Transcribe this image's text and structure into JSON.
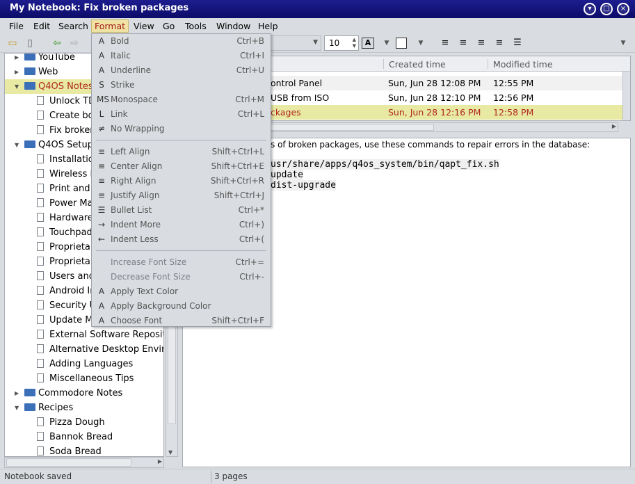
{
  "window": {
    "title": "My Notebook: Fix broken packages"
  },
  "menubar": [
    "File",
    "Edit",
    "Search",
    "Format",
    "View",
    "Go",
    "Tools",
    "Window",
    "Help"
  ],
  "toolbar": {
    "font_size": "10"
  },
  "tree": [
    {
      "label": "YouTube",
      "type": "folder",
      "level": 1,
      "expander": "collapsed"
    },
    {
      "label": "Web",
      "type": "folder",
      "level": 1,
      "expander": "collapsed"
    },
    {
      "label": "Q4OS Notes",
      "type": "folder",
      "level": 1,
      "expander": "expanded",
      "selected": true
    },
    {
      "label": "Unlock TDE",
      "type": "page",
      "level": 2
    },
    {
      "label": "Create boo",
      "type": "page",
      "level": 2
    },
    {
      "label": "Fix broken",
      "type": "page",
      "level": 2
    },
    {
      "label": "Q4OS Setup",
      "type": "folder",
      "level": 1,
      "expander": "expanded"
    },
    {
      "label": "Installation",
      "type": "page",
      "level": 2
    },
    {
      "label": "Wireless N",
      "type": "page",
      "level": 2
    },
    {
      "label": "Print and S",
      "type": "page",
      "level": 2
    },
    {
      "label": "Power Man",
      "type": "page",
      "level": 2
    },
    {
      "label": "Hardware",
      "type": "page",
      "level": 2
    },
    {
      "label": "Touchpad",
      "type": "page",
      "level": 2
    },
    {
      "label": "Proprietary",
      "type": "page",
      "level": 2
    },
    {
      "label": "Proprietary",
      "type": "page",
      "level": 2
    },
    {
      "label": "Users and",
      "type": "page",
      "level": 2
    },
    {
      "label": "Android In",
      "type": "page",
      "level": 2
    },
    {
      "label": "Security Up",
      "type": "page",
      "level": 2
    },
    {
      "label": "Update Ma",
      "type": "page",
      "level": 2
    },
    {
      "label": "External Software Repositori",
      "type": "page",
      "level": 2
    },
    {
      "label": "Alternative Desktop Environn",
      "type": "page",
      "level": 2
    },
    {
      "label": "Adding Languages",
      "type": "page",
      "level": 2
    },
    {
      "label": "Miscellaneous Tips",
      "type": "page",
      "level": 2
    },
    {
      "label": "Commodore Notes",
      "type": "folder",
      "level": 1,
      "expander": "collapsed"
    },
    {
      "label": "Recipes",
      "type": "folder",
      "level": 1,
      "expander": "expanded"
    },
    {
      "label": "Pizza Dough",
      "type": "page",
      "level": 2
    },
    {
      "label": "Bannok Bread",
      "type": "page",
      "level": 2
    },
    {
      "label": "Soda Bread",
      "type": "page",
      "level": 2
    }
  ],
  "pages_list": {
    "columns": [
      "Created time",
      "Modified time"
    ],
    "rows": [
      {
        "title": "ontrol Panel",
        "created": "Sun, Jun 28 12:08 PM",
        "modified": "12:55 PM"
      },
      {
        "title": "USB from ISO",
        "created": "Sun, Jun 28 12:10 PM",
        "modified": "12:56 PM"
      },
      {
        "title": "ckages",
        "created": "Sun, Jun 28 12:16 PM",
        "modified": "12:58 PM",
        "selected": true
      }
    ]
  },
  "editor": {
    "lines": [
      "s of broken packages, use these commands to repair errors in the database:",
      "usr/share/apps/q4os_system/bin/qapt_fix.sh",
      "update",
      "dist-upgrade"
    ]
  },
  "format_menu": [
    {
      "icon": "A",
      "label": "Bold",
      "shortcut": "Ctrl+B",
      "enabled": true
    },
    {
      "icon": "A",
      "label": "Italic",
      "shortcut": "Ctrl+I",
      "enabled": true
    },
    {
      "icon": "A",
      "label": "Underline",
      "shortcut": "Ctrl+U",
      "enabled": true
    },
    {
      "icon": "S",
      "label": "Strike",
      "shortcut": "",
      "enabled": true
    },
    {
      "icon": "MS",
      "label": "Monospace",
      "shortcut": "Ctrl+M",
      "enabled": true
    },
    {
      "icon": "L",
      "label": "Link",
      "shortcut": "Ctrl+L",
      "enabled": true
    },
    {
      "icon": "≠",
      "label": "No Wrapping",
      "shortcut": "",
      "enabled": true
    },
    {
      "divider": true
    },
    {
      "icon": "≡",
      "label": "Left Align",
      "shortcut": "Shift+Ctrl+L",
      "enabled": true
    },
    {
      "icon": "≡",
      "label": "Center Align",
      "shortcut": "Shift+Ctrl+E",
      "enabled": true
    },
    {
      "icon": "≡",
      "label": "Right Align",
      "shortcut": "Shift+Ctrl+R",
      "enabled": true
    },
    {
      "icon": "≡",
      "label": "Justify Align",
      "shortcut": "Shift+Ctrl+J",
      "enabled": true
    },
    {
      "icon": "☰",
      "label": "Bullet List",
      "shortcut": "Ctrl+*",
      "enabled": true
    },
    {
      "icon": "→",
      "label": "Indent More",
      "shortcut": "Ctrl+)",
      "enabled": true
    },
    {
      "icon": "←",
      "label": "Indent Less",
      "shortcut": "Ctrl+(",
      "enabled": true
    },
    {
      "divider": true
    },
    {
      "icon": "",
      "label": "Increase Font Size",
      "shortcut": "Ctrl+=",
      "enabled": false
    },
    {
      "icon": "",
      "label": "Decrease Font Size",
      "shortcut": "Ctrl+-",
      "enabled": false
    },
    {
      "icon": "A",
      "label": "Apply Text Color",
      "shortcut": "",
      "enabled": true
    },
    {
      "icon": "A",
      "label": "Apply Background Color",
      "shortcut": "",
      "enabled": true
    },
    {
      "icon": "A",
      "label": "Choose Font",
      "shortcut": "Shift+Ctrl+F",
      "enabled": true
    }
  ],
  "status": {
    "message": "Notebook saved",
    "pages_count": "3 pages"
  },
  "colors": {
    "title_bar": "#10107a",
    "selection": "#e8eaa4",
    "selected_text": "#b0281b",
    "menu_active": "#f0e2a2"
  }
}
